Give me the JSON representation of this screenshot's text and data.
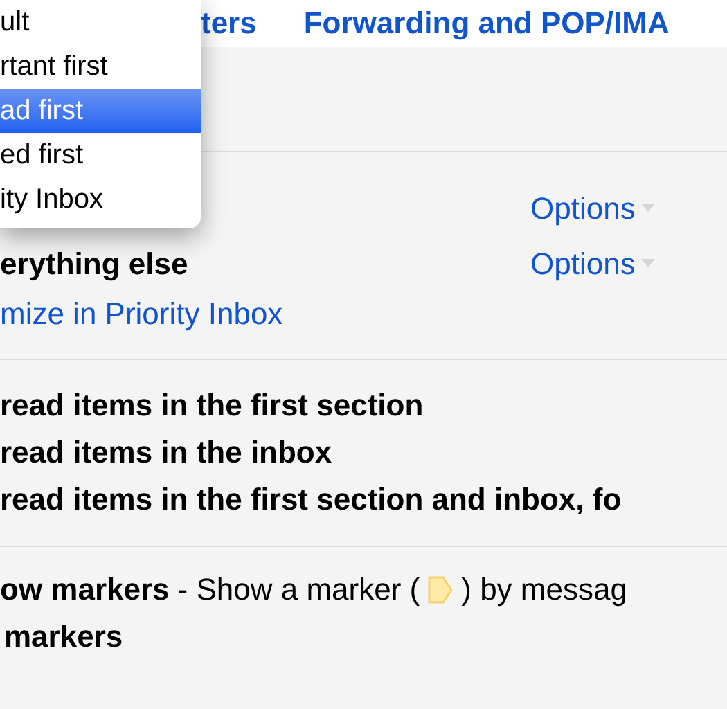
{
  "tabs": [
    {
      "label": "ters"
    },
    {
      "label": "Forwarding and POP/IMA"
    }
  ],
  "dropdown_menu": {
    "items": [
      {
        "label": "ult",
        "selected": false
      },
      {
        "label": "rtant first",
        "selected": false
      },
      {
        "label": "ad first",
        "selected": true
      },
      {
        "label": "ed first",
        "selected": false
      },
      {
        "label": "ity Inbox",
        "selected": false
      }
    ]
  },
  "inbox_sections": [
    {
      "options": "Options"
    },
    {
      "label": "erything else",
      "options": "Options"
    }
  ],
  "customize_link": "mize in Priority Inbox",
  "unread_options": [
    "read items in the first section",
    "read items in the inbox",
    "read items in the first section and inbox, fo"
  ],
  "markers": {
    "option_label": "ow markers",
    "description_before": "- Show a marker (",
    "description_after": ") by messag",
    "second_option": "markers"
  }
}
